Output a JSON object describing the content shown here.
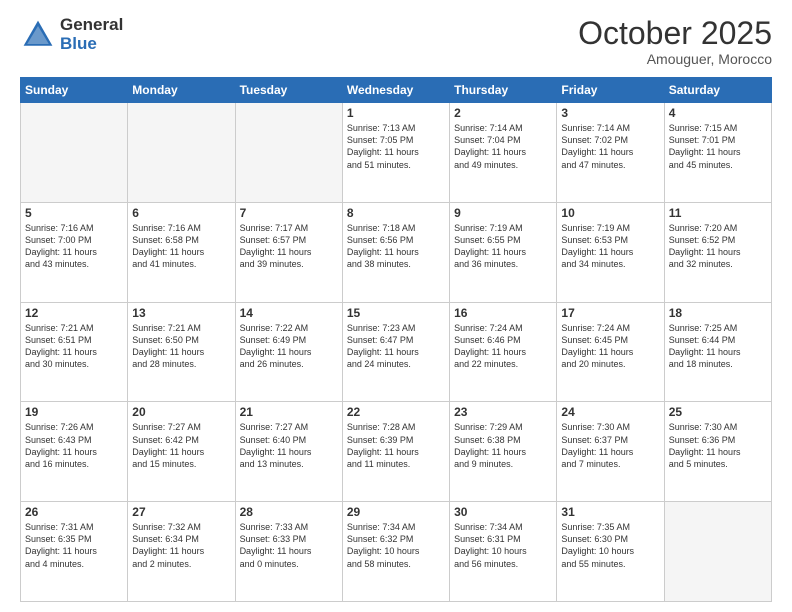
{
  "logo": {
    "general": "General",
    "blue": "Blue"
  },
  "header": {
    "month": "October 2025",
    "location": "Amouguer, Morocco"
  },
  "days": [
    "Sunday",
    "Monday",
    "Tuesday",
    "Wednesday",
    "Thursday",
    "Friday",
    "Saturday"
  ],
  "weeks": [
    [
      {
        "day": "",
        "info": ""
      },
      {
        "day": "",
        "info": ""
      },
      {
        "day": "",
        "info": ""
      },
      {
        "day": "1",
        "info": "Sunrise: 7:13 AM\nSunset: 7:05 PM\nDaylight: 11 hours\nand 51 minutes."
      },
      {
        "day": "2",
        "info": "Sunrise: 7:14 AM\nSunset: 7:04 PM\nDaylight: 11 hours\nand 49 minutes."
      },
      {
        "day": "3",
        "info": "Sunrise: 7:14 AM\nSunset: 7:02 PM\nDaylight: 11 hours\nand 47 minutes."
      },
      {
        "day": "4",
        "info": "Sunrise: 7:15 AM\nSunset: 7:01 PM\nDaylight: 11 hours\nand 45 minutes."
      }
    ],
    [
      {
        "day": "5",
        "info": "Sunrise: 7:16 AM\nSunset: 7:00 PM\nDaylight: 11 hours\nand 43 minutes."
      },
      {
        "day": "6",
        "info": "Sunrise: 7:16 AM\nSunset: 6:58 PM\nDaylight: 11 hours\nand 41 minutes."
      },
      {
        "day": "7",
        "info": "Sunrise: 7:17 AM\nSunset: 6:57 PM\nDaylight: 11 hours\nand 39 minutes."
      },
      {
        "day": "8",
        "info": "Sunrise: 7:18 AM\nSunset: 6:56 PM\nDaylight: 11 hours\nand 38 minutes."
      },
      {
        "day": "9",
        "info": "Sunrise: 7:19 AM\nSunset: 6:55 PM\nDaylight: 11 hours\nand 36 minutes."
      },
      {
        "day": "10",
        "info": "Sunrise: 7:19 AM\nSunset: 6:53 PM\nDaylight: 11 hours\nand 34 minutes."
      },
      {
        "day": "11",
        "info": "Sunrise: 7:20 AM\nSunset: 6:52 PM\nDaylight: 11 hours\nand 32 minutes."
      }
    ],
    [
      {
        "day": "12",
        "info": "Sunrise: 7:21 AM\nSunset: 6:51 PM\nDaylight: 11 hours\nand 30 minutes."
      },
      {
        "day": "13",
        "info": "Sunrise: 7:21 AM\nSunset: 6:50 PM\nDaylight: 11 hours\nand 28 minutes."
      },
      {
        "day": "14",
        "info": "Sunrise: 7:22 AM\nSunset: 6:49 PM\nDaylight: 11 hours\nand 26 minutes."
      },
      {
        "day": "15",
        "info": "Sunrise: 7:23 AM\nSunset: 6:47 PM\nDaylight: 11 hours\nand 24 minutes."
      },
      {
        "day": "16",
        "info": "Sunrise: 7:24 AM\nSunset: 6:46 PM\nDaylight: 11 hours\nand 22 minutes."
      },
      {
        "day": "17",
        "info": "Sunrise: 7:24 AM\nSunset: 6:45 PM\nDaylight: 11 hours\nand 20 minutes."
      },
      {
        "day": "18",
        "info": "Sunrise: 7:25 AM\nSunset: 6:44 PM\nDaylight: 11 hours\nand 18 minutes."
      }
    ],
    [
      {
        "day": "19",
        "info": "Sunrise: 7:26 AM\nSunset: 6:43 PM\nDaylight: 11 hours\nand 16 minutes."
      },
      {
        "day": "20",
        "info": "Sunrise: 7:27 AM\nSunset: 6:42 PM\nDaylight: 11 hours\nand 15 minutes."
      },
      {
        "day": "21",
        "info": "Sunrise: 7:27 AM\nSunset: 6:40 PM\nDaylight: 11 hours\nand 13 minutes."
      },
      {
        "day": "22",
        "info": "Sunrise: 7:28 AM\nSunset: 6:39 PM\nDaylight: 11 hours\nand 11 minutes."
      },
      {
        "day": "23",
        "info": "Sunrise: 7:29 AM\nSunset: 6:38 PM\nDaylight: 11 hours\nand 9 minutes."
      },
      {
        "day": "24",
        "info": "Sunrise: 7:30 AM\nSunset: 6:37 PM\nDaylight: 11 hours\nand 7 minutes."
      },
      {
        "day": "25",
        "info": "Sunrise: 7:30 AM\nSunset: 6:36 PM\nDaylight: 11 hours\nand 5 minutes."
      }
    ],
    [
      {
        "day": "26",
        "info": "Sunrise: 7:31 AM\nSunset: 6:35 PM\nDaylight: 11 hours\nand 4 minutes."
      },
      {
        "day": "27",
        "info": "Sunrise: 7:32 AM\nSunset: 6:34 PM\nDaylight: 11 hours\nand 2 minutes."
      },
      {
        "day": "28",
        "info": "Sunrise: 7:33 AM\nSunset: 6:33 PM\nDaylight: 11 hours\nand 0 minutes."
      },
      {
        "day": "29",
        "info": "Sunrise: 7:34 AM\nSunset: 6:32 PM\nDaylight: 10 hours\nand 58 minutes."
      },
      {
        "day": "30",
        "info": "Sunrise: 7:34 AM\nSunset: 6:31 PM\nDaylight: 10 hours\nand 56 minutes."
      },
      {
        "day": "31",
        "info": "Sunrise: 7:35 AM\nSunset: 6:30 PM\nDaylight: 10 hours\nand 55 minutes."
      },
      {
        "day": "",
        "info": ""
      }
    ]
  ]
}
